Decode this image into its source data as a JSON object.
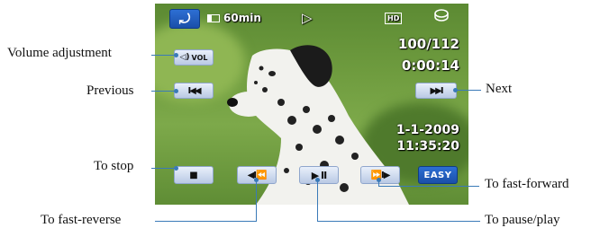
{
  "callouts": {
    "volume": "Volume adjustment",
    "previous": "Previous",
    "next": "Next",
    "stop": "To stop",
    "fast_forward": "To fast-forward",
    "fast_reverse": "To fast-reverse",
    "pause_play": "To pause/play"
  },
  "osd": {
    "battery": "60min",
    "quality": "HD",
    "counter": "100/112",
    "elapsed": "0:00:14",
    "date": "1-1-2009",
    "time": "11:35:20"
  },
  "buttons": {
    "volume": "VOL",
    "easy": "EASY"
  },
  "colors": {
    "leader_line": "#3a7ab8",
    "back_button": "#1a4fa8"
  }
}
